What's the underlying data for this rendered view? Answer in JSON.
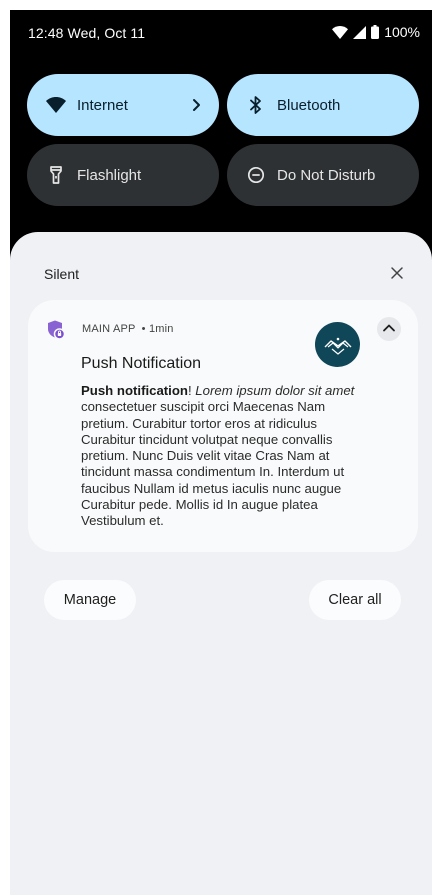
{
  "status_bar": {
    "time": "12:48 Wed, Oct 11",
    "battery": "100%",
    "icons": [
      "wifi-icon",
      "cellular-signal-icon",
      "battery-icon"
    ]
  },
  "quick_settings": {
    "tiles": [
      {
        "label": "Internet",
        "icon": "wifi-icon",
        "state": "on",
        "has_chevron": true
      },
      {
        "label": "Bluetooth",
        "icon": "bluetooth-icon",
        "state": "on"
      },
      {
        "label": "Flashlight",
        "icon": "flashlight-icon",
        "state": "off"
      },
      {
        "label": "Do Not Disturb",
        "icon": "do-not-disturb-icon",
        "state": "off"
      }
    ],
    "colors": {
      "on": "#b6e5ff",
      "off": "#2e3133"
    }
  },
  "notifications": {
    "section_label": "Silent",
    "card": {
      "app_name": "MAIN APP",
      "separator": "•",
      "time": "1min",
      "title": "Push Notification",
      "body_bold": "Push notification",
      "body_excl": "!",
      "body_italic": " Lorem ipsum dolor sit amet",
      "body_rest": " consectetuer suscipit orci Maecenas Nam pretium. Curabitur tortor eros at ridiculus Curabitur tincidunt volutpat neque convallis pretium. Nunc Duis velit vitae Cras Nam at tincidunt massa condimentum In. Interdum ut faucibus Nullam id metus iaculis nunc augue Curabitur pede. Mollis id In augue platea Vestibulum et."
    },
    "actions": {
      "manage": "Manage",
      "clear_all": "Clear all"
    }
  }
}
